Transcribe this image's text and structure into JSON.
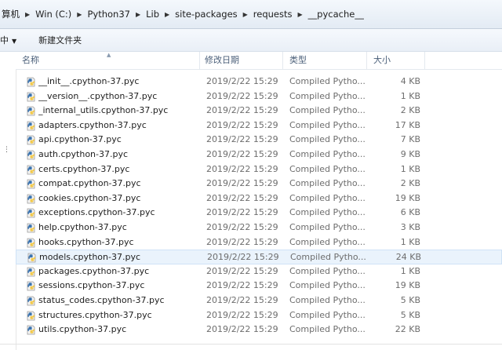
{
  "breadcrumb": {
    "items": [
      "算机",
      "Win (C:)",
      "Python37",
      "Lib",
      "site-packages",
      "requests",
      "__pycache__"
    ]
  },
  "toolbar": {
    "organize_label": "中",
    "new_folder_label": "新建文件夹"
  },
  "columns": {
    "name": "名称",
    "date": "修改日期",
    "type": "类型",
    "size": "大小"
  },
  "icon": "python-compiled-file-icon",
  "colors": {
    "selection": "#eaf3fc",
    "header_text": "#4c607a",
    "meta_text": "#6d6d6d"
  },
  "files": [
    {
      "name": "__init__.cpython-37.pyc",
      "date": "2019/2/22 15:29",
      "type": "Compiled Pytho...",
      "size": "4 KB"
    },
    {
      "name": "__version__.cpython-37.pyc",
      "date": "2019/2/22 15:29",
      "type": "Compiled Pytho...",
      "size": "1 KB"
    },
    {
      "name": "_internal_utils.cpython-37.pyc",
      "date": "2019/2/22 15:29",
      "type": "Compiled Pytho...",
      "size": "2 KB"
    },
    {
      "name": "adapters.cpython-37.pyc",
      "date": "2019/2/22 15:29",
      "type": "Compiled Pytho...",
      "size": "17 KB"
    },
    {
      "name": "api.cpython-37.pyc",
      "date": "2019/2/22 15:29",
      "type": "Compiled Pytho...",
      "size": "7 KB"
    },
    {
      "name": "auth.cpython-37.pyc",
      "date": "2019/2/22 15:29",
      "type": "Compiled Pytho...",
      "size": "9 KB"
    },
    {
      "name": "certs.cpython-37.pyc",
      "date": "2019/2/22 15:29",
      "type": "Compiled Pytho...",
      "size": "1 KB"
    },
    {
      "name": "compat.cpython-37.pyc",
      "date": "2019/2/22 15:29",
      "type": "Compiled Pytho...",
      "size": "2 KB"
    },
    {
      "name": "cookies.cpython-37.pyc",
      "date": "2019/2/22 15:29",
      "type": "Compiled Pytho...",
      "size": "19 KB"
    },
    {
      "name": "exceptions.cpython-37.pyc",
      "date": "2019/2/22 15:29",
      "type": "Compiled Pytho...",
      "size": "6 KB"
    },
    {
      "name": "help.cpython-37.pyc",
      "date": "2019/2/22 15:29",
      "type": "Compiled Pytho...",
      "size": "3 KB"
    },
    {
      "name": "hooks.cpython-37.pyc",
      "date": "2019/2/22 15:29",
      "type": "Compiled Pytho...",
      "size": "1 KB"
    },
    {
      "name": "models.cpython-37.pyc",
      "date": "2019/2/22 15:29",
      "type": "Compiled Pytho...",
      "size": "24 KB",
      "selected": true
    },
    {
      "name": "packages.cpython-37.pyc",
      "date": "2019/2/22 15:29",
      "type": "Compiled Pytho...",
      "size": "1 KB"
    },
    {
      "name": "sessions.cpython-37.pyc",
      "date": "2019/2/22 15:29",
      "type": "Compiled Pytho...",
      "size": "19 KB"
    },
    {
      "name": "status_codes.cpython-37.pyc",
      "date": "2019/2/22 15:29",
      "type": "Compiled Pytho...",
      "size": "5 KB"
    },
    {
      "name": "structures.cpython-37.pyc",
      "date": "2019/2/22 15:29",
      "type": "Compiled Pytho...",
      "size": "5 KB"
    },
    {
      "name": "utils.cpython-37.pyc",
      "date": "2019/2/22 15:29",
      "type": "Compiled Pytho...",
      "size": "22 KB"
    }
  ]
}
